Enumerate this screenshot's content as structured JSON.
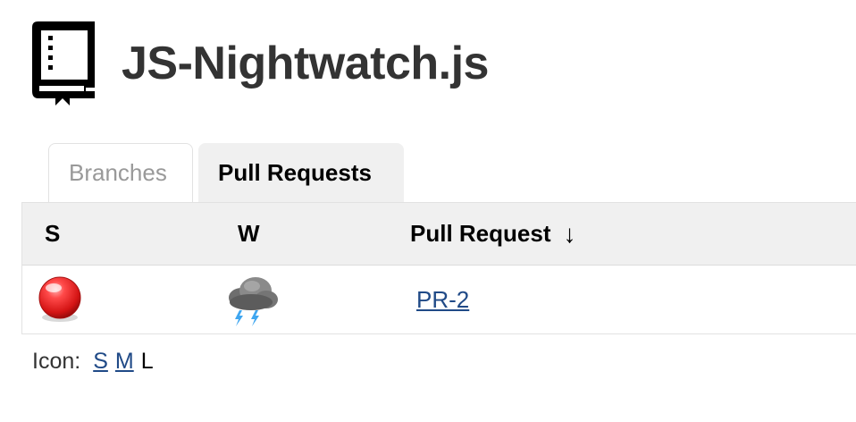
{
  "header": {
    "icon": "book-icon",
    "title": "JS-Nightwatch.js"
  },
  "tabs": [
    {
      "label": "Branches",
      "active": false
    },
    {
      "label": "Pull Requests",
      "active": true
    }
  ],
  "table": {
    "columns": [
      {
        "label": "S"
      },
      {
        "label": "W"
      },
      {
        "label": "Pull Request",
        "sort": "↓"
      }
    ],
    "rows": [
      {
        "status_icon": "red-ball-icon",
        "status_color": "#e53935",
        "weather_icon": "thunderstorm-icon",
        "name": "PR-2"
      }
    ]
  },
  "icon_size": {
    "label": "Icon:",
    "options": [
      "S",
      "M",
      "L"
    ],
    "selected": "L"
  },
  "colors": {
    "link": "#204a87",
    "header_bg": "#f0f0f0",
    "title": "#333333"
  }
}
